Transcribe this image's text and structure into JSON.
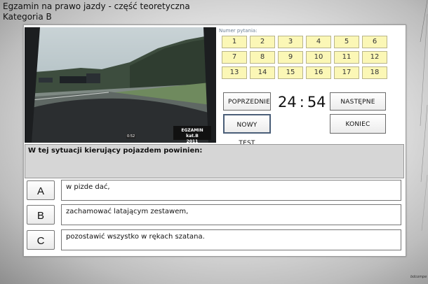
{
  "header": {
    "title": "Egzamin na prawo jazdy - część teoretyczna",
    "category": "Kategoria B"
  },
  "video": {
    "time": "0:52",
    "badge_line1": "EGZAMIN kat.B",
    "badge_line2": "2011"
  },
  "questions": {
    "label": "Numer pytania:",
    "numbers": [
      "1",
      "2",
      "3",
      "4",
      "5",
      "6",
      "7",
      "8",
      "9",
      "10",
      "11",
      "12",
      "13",
      "14",
      "15",
      "16",
      "17",
      "18"
    ]
  },
  "controls": {
    "prev": "POPRZEDNIE",
    "next": "NASTĘPNE",
    "new_test": "NOWY TEST",
    "end": "KONIEC",
    "timer_min": "24",
    "timer_sep": ":",
    "timer_sec": "54"
  },
  "question_text": "W tej sytuacji kierujący pojazdem powinien:",
  "answers": [
    {
      "letter": "A",
      "text": "w pizde dać,"
    },
    {
      "letter": "B",
      "text": "zachamować latającym zestawem,"
    },
    {
      "letter": "C",
      "text": "pozostawić wszystko w rękach szatana."
    }
  ],
  "signature": "bdcompe"
}
